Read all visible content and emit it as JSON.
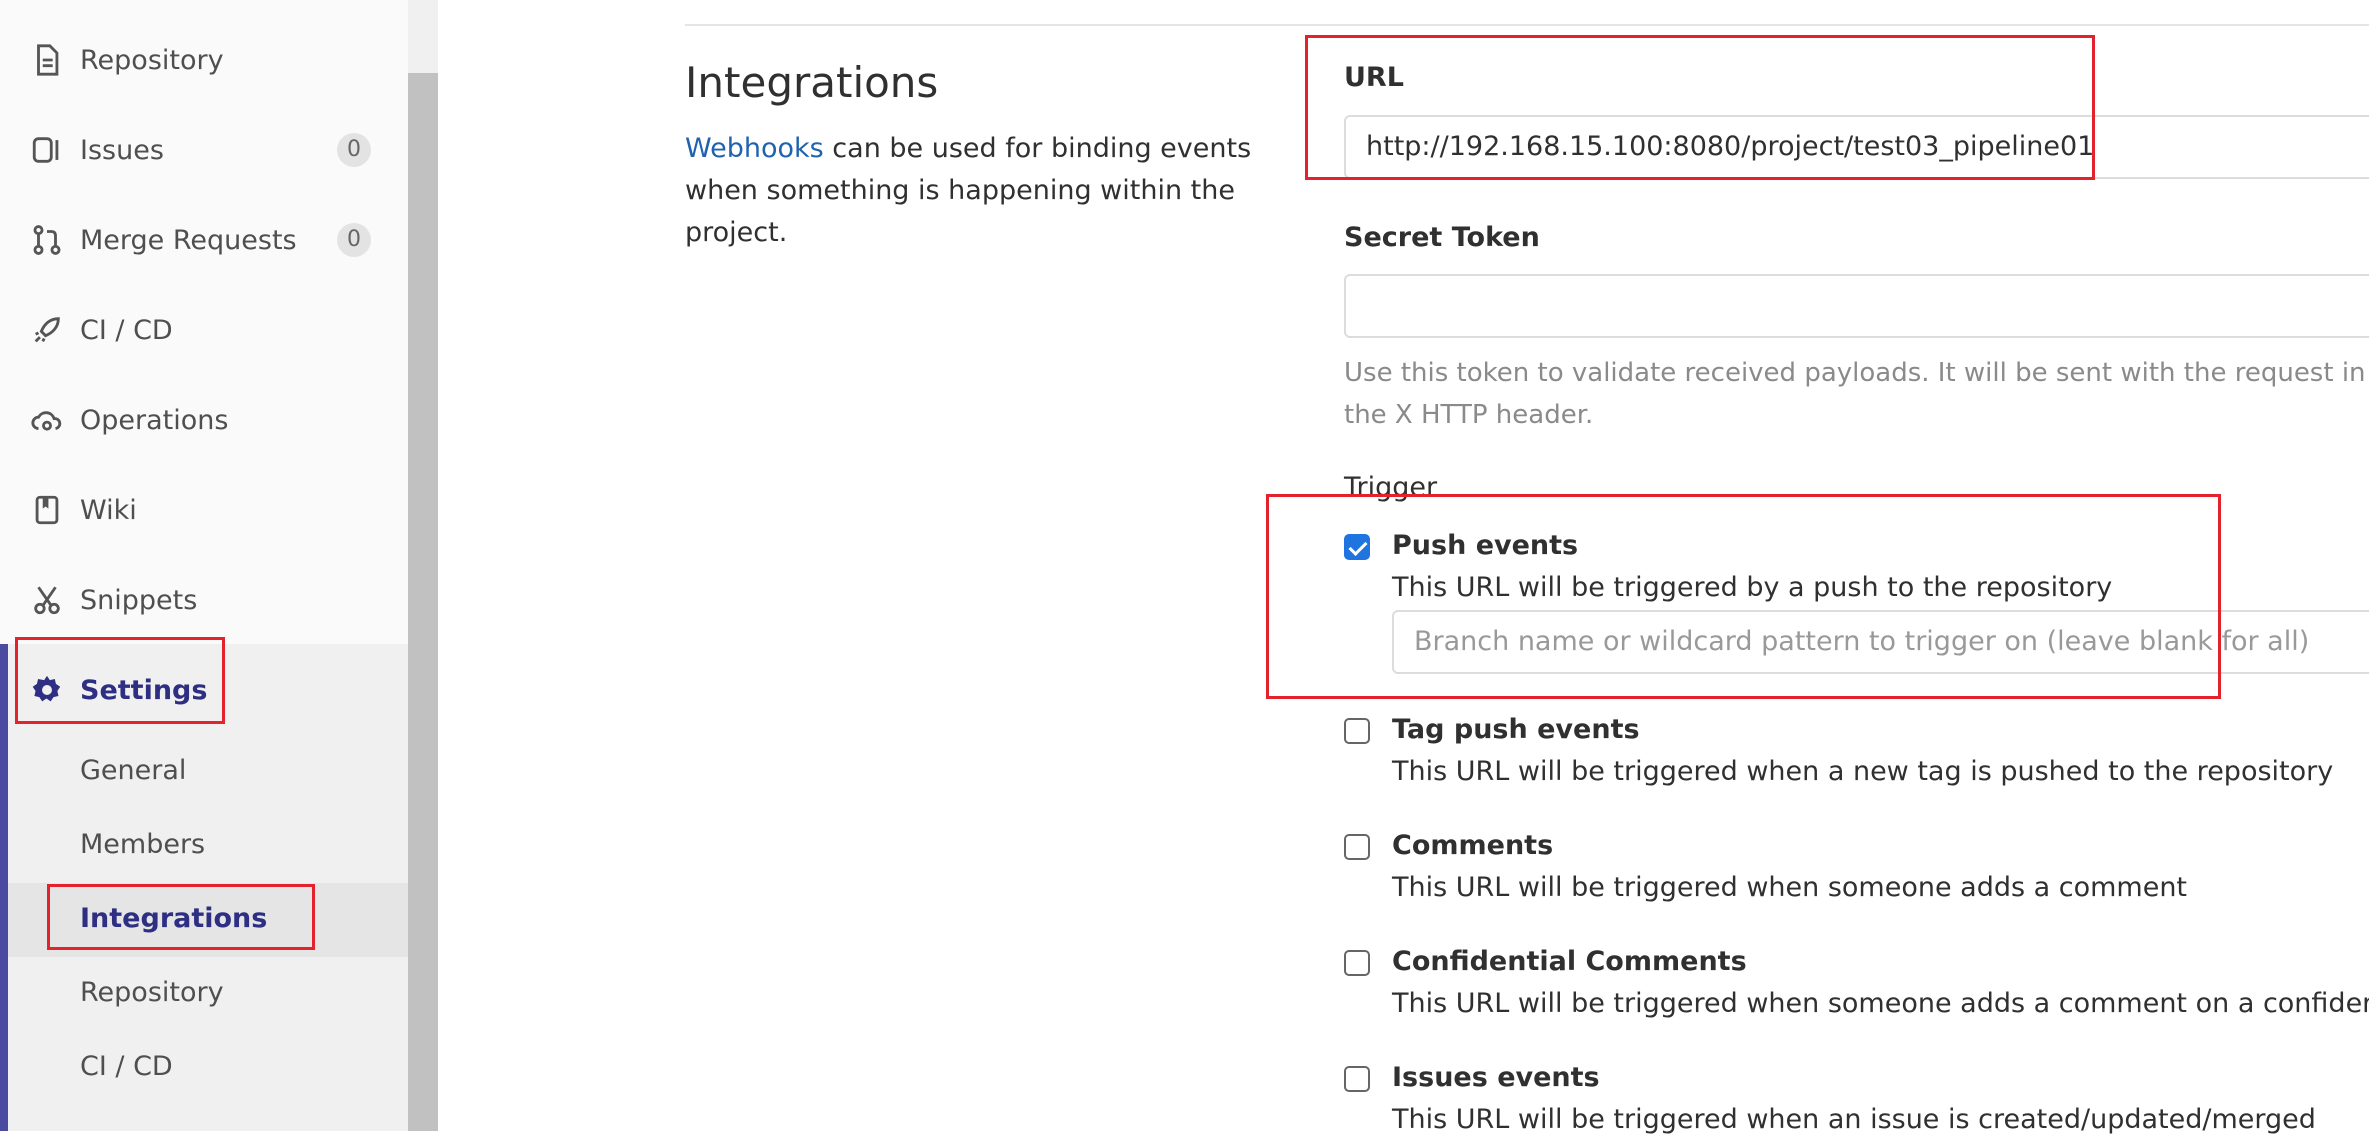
{
  "sidebar": {
    "items": [
      {
        "label": "Repository",
        "icon": "document-icon"
      },
      {
        "label": "Issues",
        "icon": "issues-icon",
        "badge": "0"
      },
      {
        "label": "Merge Requests",
        "icon": "merge-request-icon",
        "badge": "0"
      },
      {
        "label": "CI / CD",
        "icon": "rocket-icon"
      },
      {
        "label": "Operations",
        "icon": "cloud-gear-icon"
      },
      {
        "label": "Wiki",
        "icon": "book-icon"
      },
      {
        "label": "Snippets",
        "icon": "scissors-icon"
      },
      {
        "label": "Settings",
        "icon": "gear-icon"
      }
    ],
    "settings_sub": [
      "General",
      "Members",
      "Integrations",
      "Repository",
      "CI / CD"
    ]
  },
  "main": {
    "title": "Integrations",
    "desc_link": "Webhooks",
    "desc_text": " can be used for binding events when something is happening within the project.",
    "url_label": "URL",
    "url_value": "http://192.168.15.100:8080/project/test03_pipeline01",
    "token_label": "Secret Token",
    "token_value": "",
    "token_help": "Use this token to validate received payloads. It will be sent with the request in the X HTTP header.",
    "trigger_label": "Trigger",
    "branch_placeholder": "Branch name or wildcard pattern to trigger on (leave blank for all)",
    "events": [
      {
        "title": "Push events",
        "desc": "This URL will be triggered by a push to the repository",
        "checked": true
      },
      {
        "title": "Tag push events",
        "desc": "This URL will be triggered when a new tag is pushed to the repository",
        "checked": false
      },
      {
        "title": "Comments",
        "desc": "This URL will be triggered when someone adds a comment",
        "checked": false
      },
      {
        "title": "Confidential Comments",
        "desc": "This URL will be triggered when someone adds a comment on a confidential iss",
        "checked": false
      },
      {
        "title": "Issues events",
        "desc": "This URL will be triggered when an issue is created/updated/merged",
        "checked": false
      }
    ]
  },
  "colors": {
    "accent": "#2e2e82",
    "link": "#1f63b0",
    "highlight": "#e3222d",
    "checkbox": "#1f74e0"
  }
}
